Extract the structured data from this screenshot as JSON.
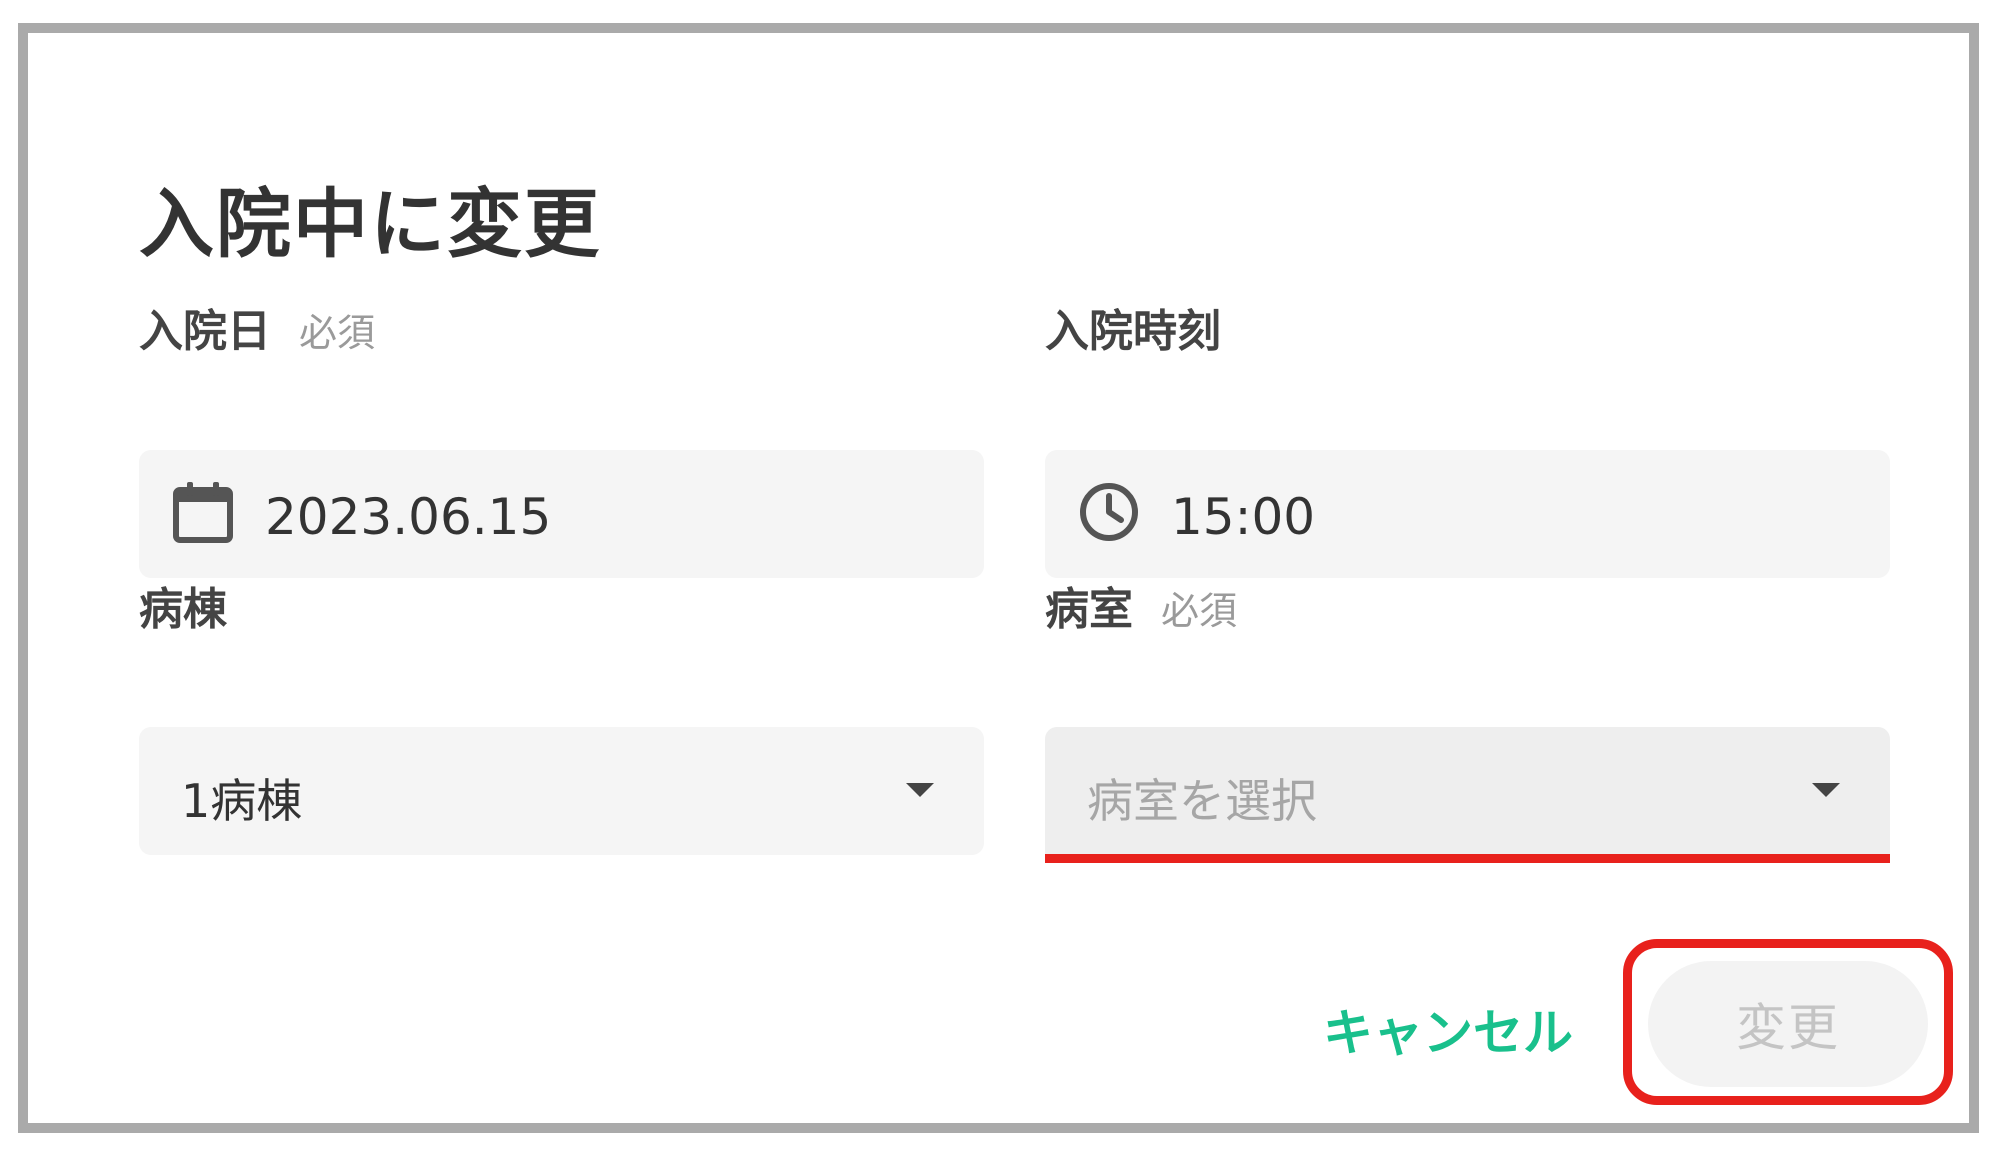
{
  "dialog": {
    "title": "入院中に変更",
    "fields": {
      "admission_date": {
        "label": "入院日",
        "required_label": "必須",
        "value": "2023.06.15",
        "icon": "calendar-icon"
      },
      "admission_time": {
        "label": "入院時刻",
        "value": "15:00",
        "icon": "clock-icon"
      },
      "ward": {
        "label": "病棟",
        "value": "1病棟"
      },
      "room": {
        "label": "病室",
        "required_label": "必須",
        "placeholder": "病室を選択"
      }
    },
    "buttons": {
      "cancel_label": "キャンセル",
      "change_label": "変更"
    }
  },
  "colors": {
    "accent": "#19c08c",
    "error": "#e8211c",
    "frame_border": "#aaaaaa",
    "field_background": "#f5f5f5",
    "disabled_text": "#c4c4c4"
  }
}
